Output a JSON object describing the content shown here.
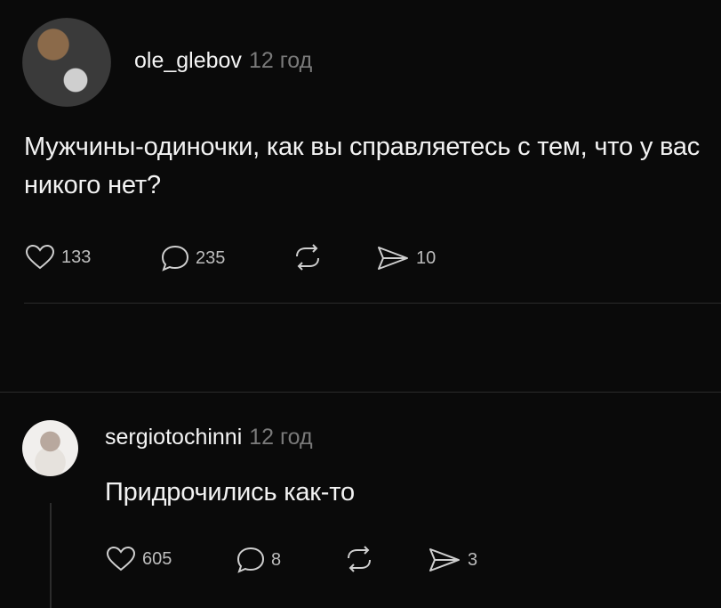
{
  "post": {
    "username": "ole_glebov",
    "time": "12 год",
    "text": "Мужчины-одиночки, как вы справляетесь с тем, что у вас никого нет?",
    "likes": "133",
    "comments": "235",
    "shares": "10"
  },
  "reply": {
    "username": "sergiotochinni",
    "time": "12 год",
    "text": "Придрочились как-то",
    "likes": "605",
    "comments": "8",
    "shares": "3"
  },
  "icons": {
    "like": "heart-icon",
    "comment": "comment-icon",
    "repost": "repost-icon",
    "share": "send-icon"
  },
  "colors": {
    "background": "#0a0a0a",
    "text": "#f3f3f3",
    "secondary": "#7a7a7a"
  }
}
